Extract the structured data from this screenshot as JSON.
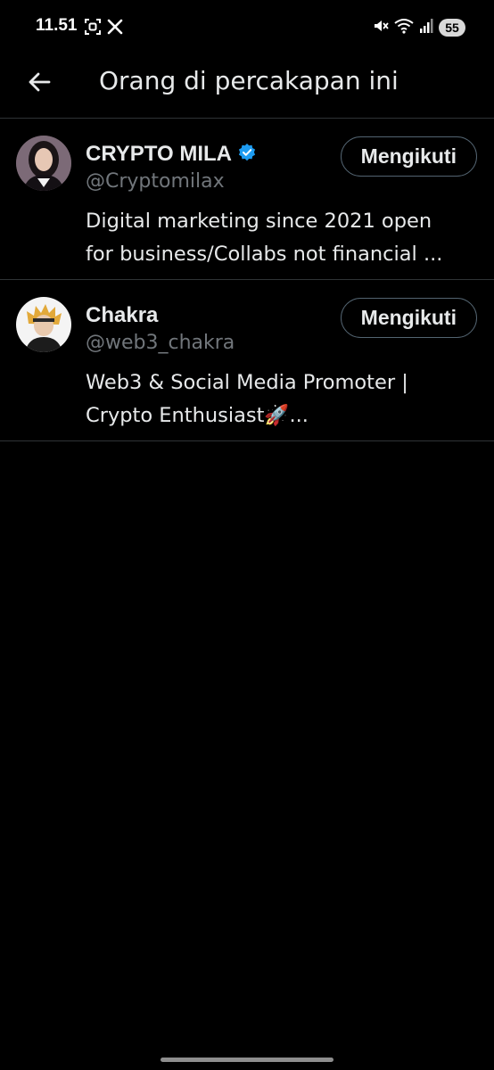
{
  "status_bar": {
    "time": "11.51",
    "battery": "55",
    "left_icons": [
      "screenshot-icon",
      "x-logo-icon"
    ],
    "right_icons": [
      "mute-icon",
      "wifi-icon",
      "signal-icon"
    ]
  },
  "header": {
    "back_icon": "arrow-left-icon",
    "title": "Orang di percakapan ini"
  },
  "users": [
    {
      "name": "CRYPTO MILA",
      "verified": true,
      "handle": "@Cryptomilax",
      "bio_lines": [
        "Digital marketing since 2021 open",
        "for business/Collabs not financial ..."
      ],
      "follow_label": "Mengikuti"
    },
    {
      "name": "Chakra",
      "verified": false,
      "handle": "@web3_chakra",
      "bio_lines": [
        "Web3 & Social Media Promoter |",
        "Crypto Enthusiast🚀..."
      ],
      "follow_label": "Mengikuti"
    }
  ],
  "colors": {
    "background": "#000000",
    "text_primary": "#e7e9ea",
    "text_secondary": "#71767b",
    "divider": "#2f3336",
    "verified_blue": "#1d9bf0"
  }
}
